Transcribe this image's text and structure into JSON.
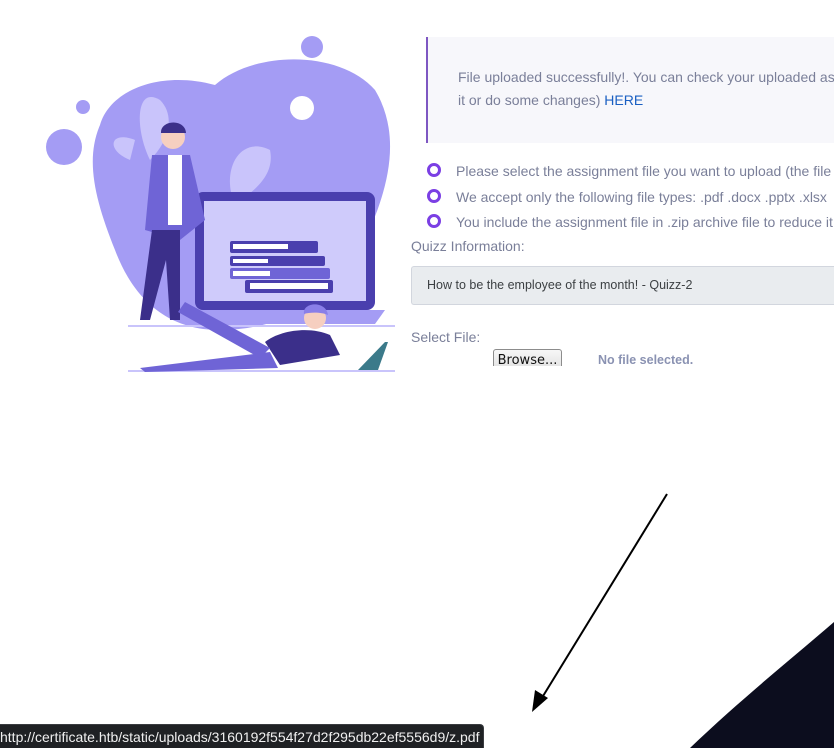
{
  "alert": {
    "message_line1": "File uploaded successfully!. You can check your uploaded as",
    "message_line2": "it or do some changes)",
    "link_text": "HERE"
  },
  "instructions": [
    "Please select the assignment file you want to upload (the file",
    "We accept only the following file types: .pdf .docx .pptx .xlsx",
    "You include the assignment file in .zip archive file to reduce it"
  ],
  "form": {
    "quiz_label": "Quizz Information:",
    "quiz_value": "How to be the employee of the month! - Quizz-2",
    "file_label": "Select File:",
    "browse_label": "Browse...",
    "file_status": "No file selected."
  },
  "status_bar": {
    "url": "http://certificate.htb/static/uploads/3160192f554f27d2f295db22ef5556d9/z.pdf"
  },
  "colors": {
    "accent": "#7b3fe4",
    "link": "#1a5fc2",
    "illustration_primary": "#a49cf4",
    "illustration_dark": "#4a3fae",
    "annotation_arrow": "#000000",
    "corner_shape": "#0c0d1e"
  }
}
